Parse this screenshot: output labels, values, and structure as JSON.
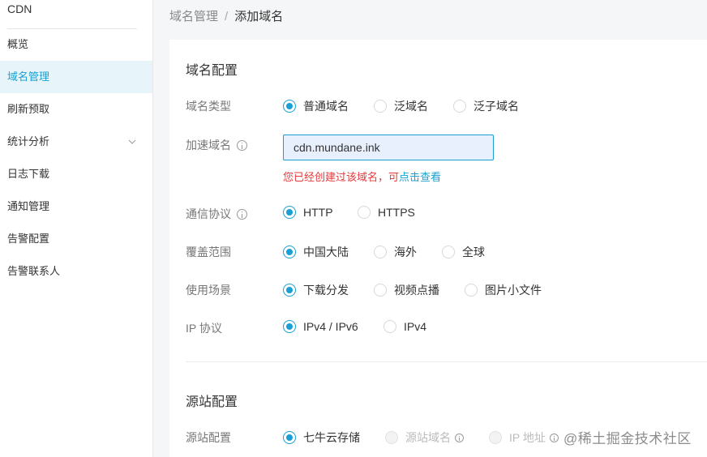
{
  "sidebar": {
    "brand": "CDN",
    "items": [
      {
        "label": "概览"
      },
      {
        "label": "域名管理"
      },
      {
        "label": "刷新预取"
      },
      {
        "label": "统计分析"
      },
      {
        "label": "日志下载"
      },
      {
        "label": "通知管理"
      },
      {
        "label": "告警配置"
      },
      {
        "label": "告警联系人"
      }
    ],
    "active_item": "域名管理"
  },
  "breadcrumb": {
    "parent": "域名管理",
    "separator": "/",
    "current": "添加域名"
  },
  "domain_config": {
    "title": "域名配置",
    "domain_type": {
      "label": "域名类型",
      "options": [
        "普通域名",
        "泛域名",
        "泛子域名"
      ],
      "selected": "普通域名"
    },
    "accel_domain": {
      "label": "加速域名",
      "value": "cdn.mundane.ink",
      "error": "您已经创建过该域名，",
      "error_link_prefix": "可",
      "error_link": "点击查看"
    },
    "protocol": {
      "label": "通信协议",
      "options": [
        "HTTP",
        "HTTPS"
      ],
      "selected": "HTTP"
    },
    "coverage": {
      "label": "覆盖范围",
      "options": [
        "中国大陆",
        "海外",
        "全球"
      ],
      "selected": "中国大陆"
    },
    "scenario": {
      "label": "使用场景",
      "options": [
        "下载分发",
        "视频点播",
        "图片小文件"
      ],
      "selected": "下载分发"
    },
    "ip_protocol": {
      "label": "IP 协议",
      "options": [
        "IPv4 / IPv6",
        "IPv4"
      ],
      "selected": "IPv4 / IPv6"
    }
  },
  "origin_config": {
    "title": "源站配置",
    "origin": {
      "label": "源站配置",
      "options": [
        "七牛云存储",
        "源站域名",
        "IP 地址"
      ],
      "selected": "七牛云存储",
      "disabled": [
        "源站域名",
        "IP 地址"
      ]
    }
  },
  "watermark": "@稀土掘金技术社区",
  "colors": {
    "accent": "#1a9fd2",
    "error": "#e4393c",
    "active_bg": "#e7f5fb"
  }
}
